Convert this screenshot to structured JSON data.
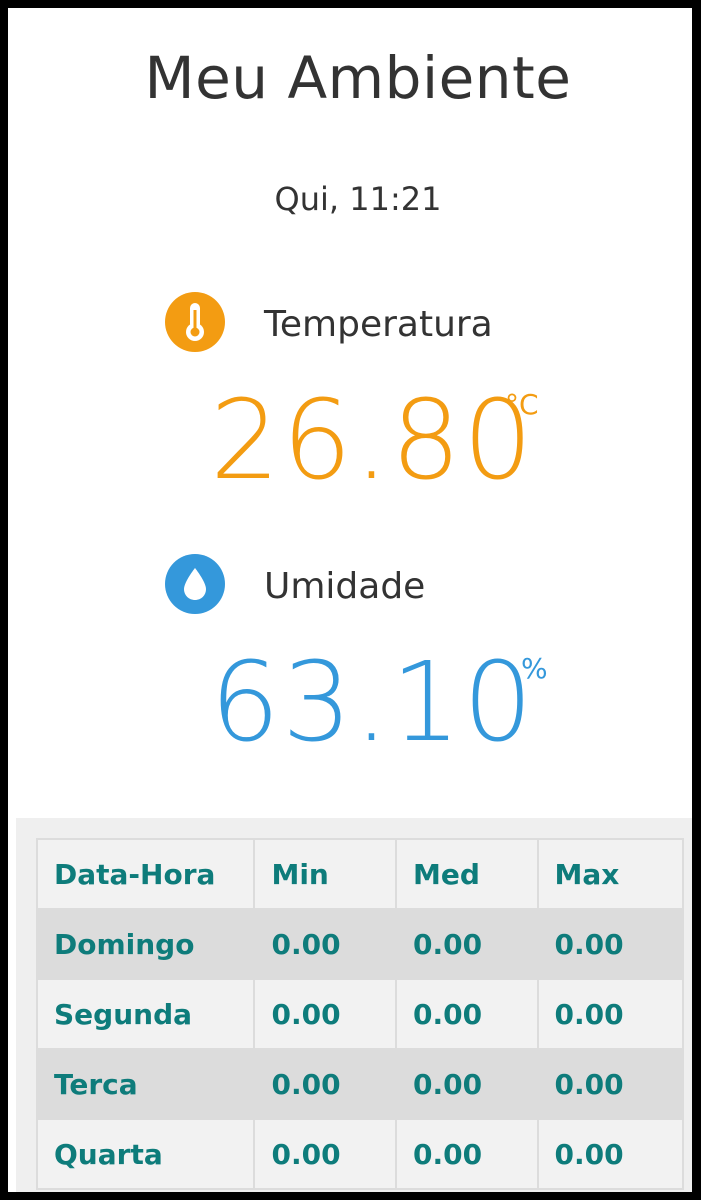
{
  "header": {
    "title": "Meu Ambiente",
    "datetime": "Qui, 11:21"
  },
  "temperature": {
    "label": "Temperatura",
    "value": "26.80",
    "unit": "°C",
    "icon": "thermometer-icon",
    "color": "#f39c12"
  },
  "humidity": {
    "label": "Umidade",
    "value": "63.10",
    "unit": "%",
    "icon": "water-drop-icon",
    "color": "#3498db"
  },
  "history_table": {
    "headers": [
      "Data-Hora",
      "Min",
      "Med",
      "Max"
    ],
    "rows": [
      [
        "Domingo",
        "0.00",
        "0.00",
        "0.00"
      ],
      [
        "Segunda",
        "0.00",
        "0.00",
        "0.00"
      ],
      [
        "Terca",
        "0.00",
        "0.00",
        "0.00"
      ],
      [
        "Quarta",
        "0.00",
        "0.00",
        "0.00"
      ]
    ],
    "text_color": "#0e7c7b"
  }
}
